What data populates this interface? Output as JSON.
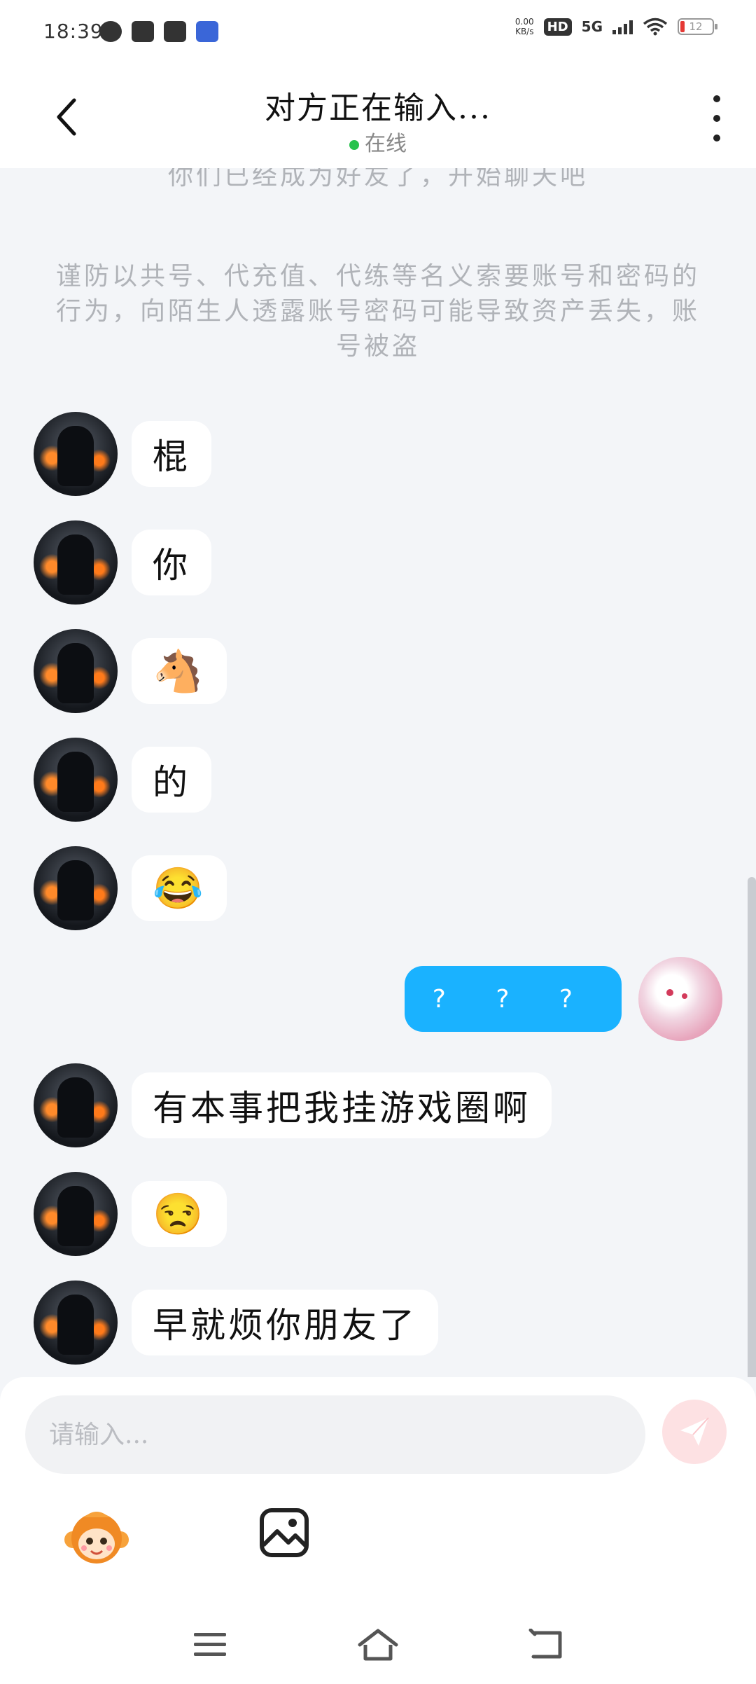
{
  "status_bar": {
    "time": "18:39",
    "net_speed_value": "0.00",
    "net_speed_unit": "KB/s",
    "hd_label": "HD",
    "network_label": "5G",
    "battery_level": "12"
  },
  "header": {
    "title": "对方正在输入...",
    "status": "在线"
  },
  "system_messages": {
    "friend_notice": "你们已经成为好友了，开始聊天吧",
    "warning": "谨防以共号、代充值、代练等名义索要账号和密码的行为，向陌生人透露账号密码可能导致资产丢失，账号被盗"
  },
  "messages": [
    {
      "side": "left",
      "text": "棍"
    },
    {
      "side": "left",
      "text": "你"
    },
    {
      "side": "left",
      "text": "🐴"
    },
    {
      "side": "left",
      "text": "的"
    },
    {
      "side": "left",
      "text": "😂"
    },
    {
      "side": "right",
      "text": "? ? ?"
    },
    {
      "side": "left",
      "text": "有本事把我挂游戏圈啊"
    },
    {
      "side": "left",
      "text": "😒"
    },
    {
      "side": "left",
      "text": "早就烦你朋友了"
    }
  ],
  "input": {
    "placeholder": "请输入..."
  },
  "colors": {
    "accent_blue": "#1ab2ff",
    "online_green": "#27c24c",
    "send_button_bg": "#fde1e3",
    "chat_background": "#f3f5f8"
  },
  "icons": {
    "back": "chevron-left-icon",
    "more": "more-vertical-icon",
    "send": "paper-plane-icon",
    "emoji_panel": "monkey-sticker-icon",
    "image": "image-icon",
    "nav_menu": "menu-icon",
    "nav_home": "home-icon",
    "nav_back": "back-icon"
  }
}
